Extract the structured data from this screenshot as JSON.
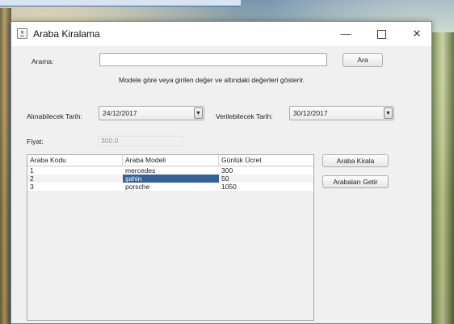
{
  "window": {
    "title": "Araba Kiralama",
    "controls": {
      "minimize": "—",
      "close": "✕"
    }
  },
  "search": {
    "label": "Arama:",
    "value": "",
    "button": "Ara"
  },
  "info_text": "Modele göre veya girilen değer ve altındaki değerleri gösterir.",
  "dates": {
    "pickup_label": "Alınabilecek Tarih:",
    "pickup_value": "24/12/2017",
    "return_label": "Verilebilecek Tarih:",
    "return_value": "30/12/2017"
  },
  "price": {
    "label": "Fiyat:",
    "value": "300.0"
  },
  "table": {
    "columns": [
      "Araba Kodu",
      "Araba Modeli",
      "Günlük Ücret"
    ],
    "rows": [
      [
        "1",
        "mercedes",
        "300"
      ],
      [
        "2",
        "şahin",
        "50"
      ],
      [
        "3",
        "porsche",
        "1050"
      ]
    ],
    "selected_row": 1,
    "selected_column": 1
  },
  "buttons": {
    "rent": "Araba Kirala",
    "fetch": "Arabaları Getir"
  },
  "colors": {
    "selection": "#33629a",
    "window_border": "#5b8cc8"
  }
}
